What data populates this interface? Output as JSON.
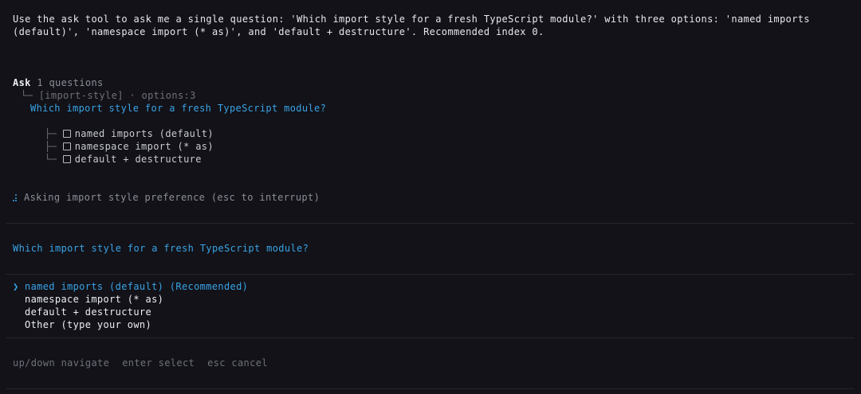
{
  "prompt": {
    "line1": "Use the ask tool to ask me a single question: 'Which import style for a fresh TypeScript module?' with three options: 'named imports",
    "line2": "(default)', 'namespace import (* as)', and 'default + destructure'. Recommended index 0."
  },
  "tool_call": {
    "name": "Ask",
    "summary": "1 questions",
    "meta": "[import-style] · options:3",
    "question": "Which import style for a fresh TypeScript module?",
    "options": [
      "named imports (default)",
      "namespace import (* as)",
      "default + destructure"
    ]
  },
  "status": {
    "text": "Asking import style preference (esc to interrupt)"
  },
  "selector": {
    "question": "Which import style for a fresh TypeScript module?",
    "caret": "❯",
    "options": [
      "named imports (default) (Recommended)",
      "namespace import (* as)",
      "default + destructure",
      "Other (type your own)"
    ]
  },
  "hints": {
    "navigate": "up/down navigate",
    "select": "enter select",
    "cancel": "esc cancel"
  },
  "colors": {
    "background": "#121218",
    "accent": "#3aa3e6",
    "muted": "#8c8e98",
    "rule": "#26272e"
  }
}
